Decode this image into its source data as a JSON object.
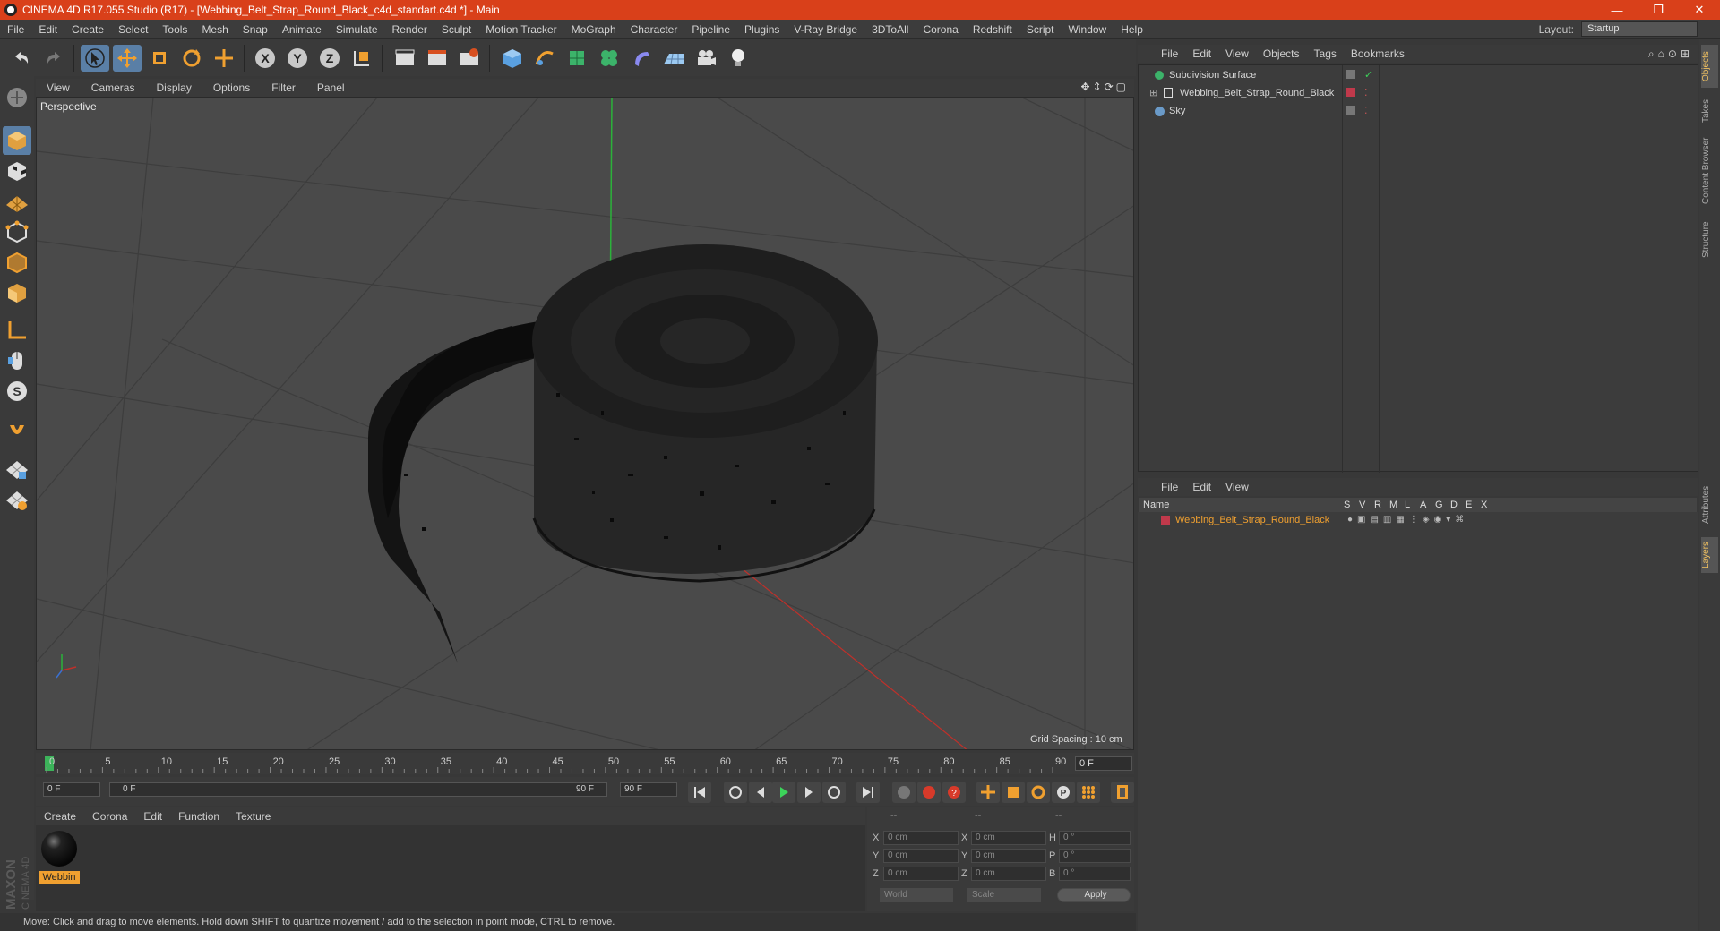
{
  "window": {
    "title": "CINEMA 4D R17.055 Studio (R17) - [Webbing_Belt_Strap_Round_Black_c4d_standart.c4d *] - Main",
    "controls": [
      "—",
      "❐",
      "✕"
    ]
  },
  "menubar": {
    "items": [
      "File",
      "Edit",
      "Create",
      "Select",
      "Tools",
      "Mesh",
      "Snap",
      "Animate",
      "Simulate",
      "Render",
      "Sculpt",
      "Motion Tracker",
      "MoGraph",
      "Character",
      "Pipeline",
      "Plugins",
      "V-Ray Bridge",
      "3DToAll",
      "Corona",
      "Redshift",
      "Script",
      "Window",
      "Help"
    ],
    "layout_label": "Layout:",
    "layout_value": "Startup"
  },
  "toolbar": {
    "icons": [
      "undo-icon",
      "redo-icon",
      "select-arrow-icon",
      "move-icon",
      "scale-icon",
      "rotate-icon",
      "transform-icon",
      "x-axis-icon",
      "y-axis-icon",
      "z-axis-icon",
      "coordinate-system-icon",
      "render-view-icon",
      "render-picture-viewer-icon",
      "edit-render-settings-icon",
      "cube-icon",
      "pen-spline-icon",
      "subdivision-icon",
      "cloner-icon",
      "deformer-icon",
      "floor-icon",
      "camera-icon",
      "light-icon"
    ],
    "axis_labels": [
      "X",
      "Y",
      "Z"
    ]
  },
  "viewport": {
    "menu": [
      "View",
      "Cameras",
      "Display",
      "Options",
      "Filter",
      "Panel"
    ],
    "label": "Perspective",
    "grid_spacing": "Grid Spacing : 10 cm"
  },
  "timeline": {
    "ticks": [
      "0",
      "5",
      "10",
      "15",
      "20",
      "25",
      "30",
      "35",
      "40",
      "45",
      "50",
      "55",
      "60",
      "65",
      "70",
      "75",
      "80",
      "85",
      "90"
    ],
    "current_frame": "0 F"
  },
  "transport": {
    "start_field": "0 F",
    "range_start": "0 F",
    "range_end": "90 F",
    "end_field": "90 F"
  },
  "material_panel": {
    "menu": [
      "Create",
      "Corona",
      "Edit",
      "Function",
      "Texture"
    ],
    "material_name": "Webbin"
  },
  "coordinates": {
    "headers": [
      "--",
      "--",
      "--"
    ],
    "rows": [
      {
        "a": "X",
        "av": "0 cm",
        "b": "X",
        "bv": "0 cm",
        "c": "H",
        "cv": "0 °"
      },
      {
        "a": "Y",
        "av": "0 cm",
        "b": "Y",
        "bv": "0 cm",
        "c": "P",
        "cv": "0 °"
      },
      {
        "a": "Z",
        "av": "0 cm",
        "b": "Z",
        "bv": "0 cm",
        "c": "B",
        "cv": "0 °"
      }
    ],
    "mode": "World",
    "scale": "Scale",
    "apply": "Apply"
  },
  "status_bar": "Move: Click and drag to move elements. Hold down SHIFT to quantize movement / add to the selection in point mode, CTRL to remove.",
  "branding": {
    "maxon": "MAXON",
    "product": "CINEMA 4D"
  },
  "object_manager": {
    "menu": [
      "File",
      "Edit",
      "View",
      "Objects",
      "Tags",
      "Bookmarks"
    ],
    "objects": [
      {
        "name": "Subdivision Surface",
        "indent": 0
      },
      {
        "name": "Webbing_Belt_Strap_Round_Black",
        "indent": 1
      },
      {
        "name": "Sky",
        "indent": 0
      }
    ]
  },
  "layer_manager": {
    "menu": [
      "File",
      "Edit",
      "View"
    ],
    "columns": [
      "Name",
      "S",
      "V",
      "R",
      "M",
      "L",
      "A",
      "G",
      "D",
      "E",
      "X"
    ],
    "layers": [
      {
        "name": "Webbing_Belt_Strap_Round_Black",
        "color": "#c0394b"
      }
    ]
  },
  "side_tabs": [
    "Objects",
    "Takes",
    "Content Browser",
    "Structure",
    "Attributes",
    "Layers"
  ],
  "colors": {
    "titlebar": "#d9401a",
    "accent": "#f0a030",
    "selection": "#5a7fa6"
  }
}
